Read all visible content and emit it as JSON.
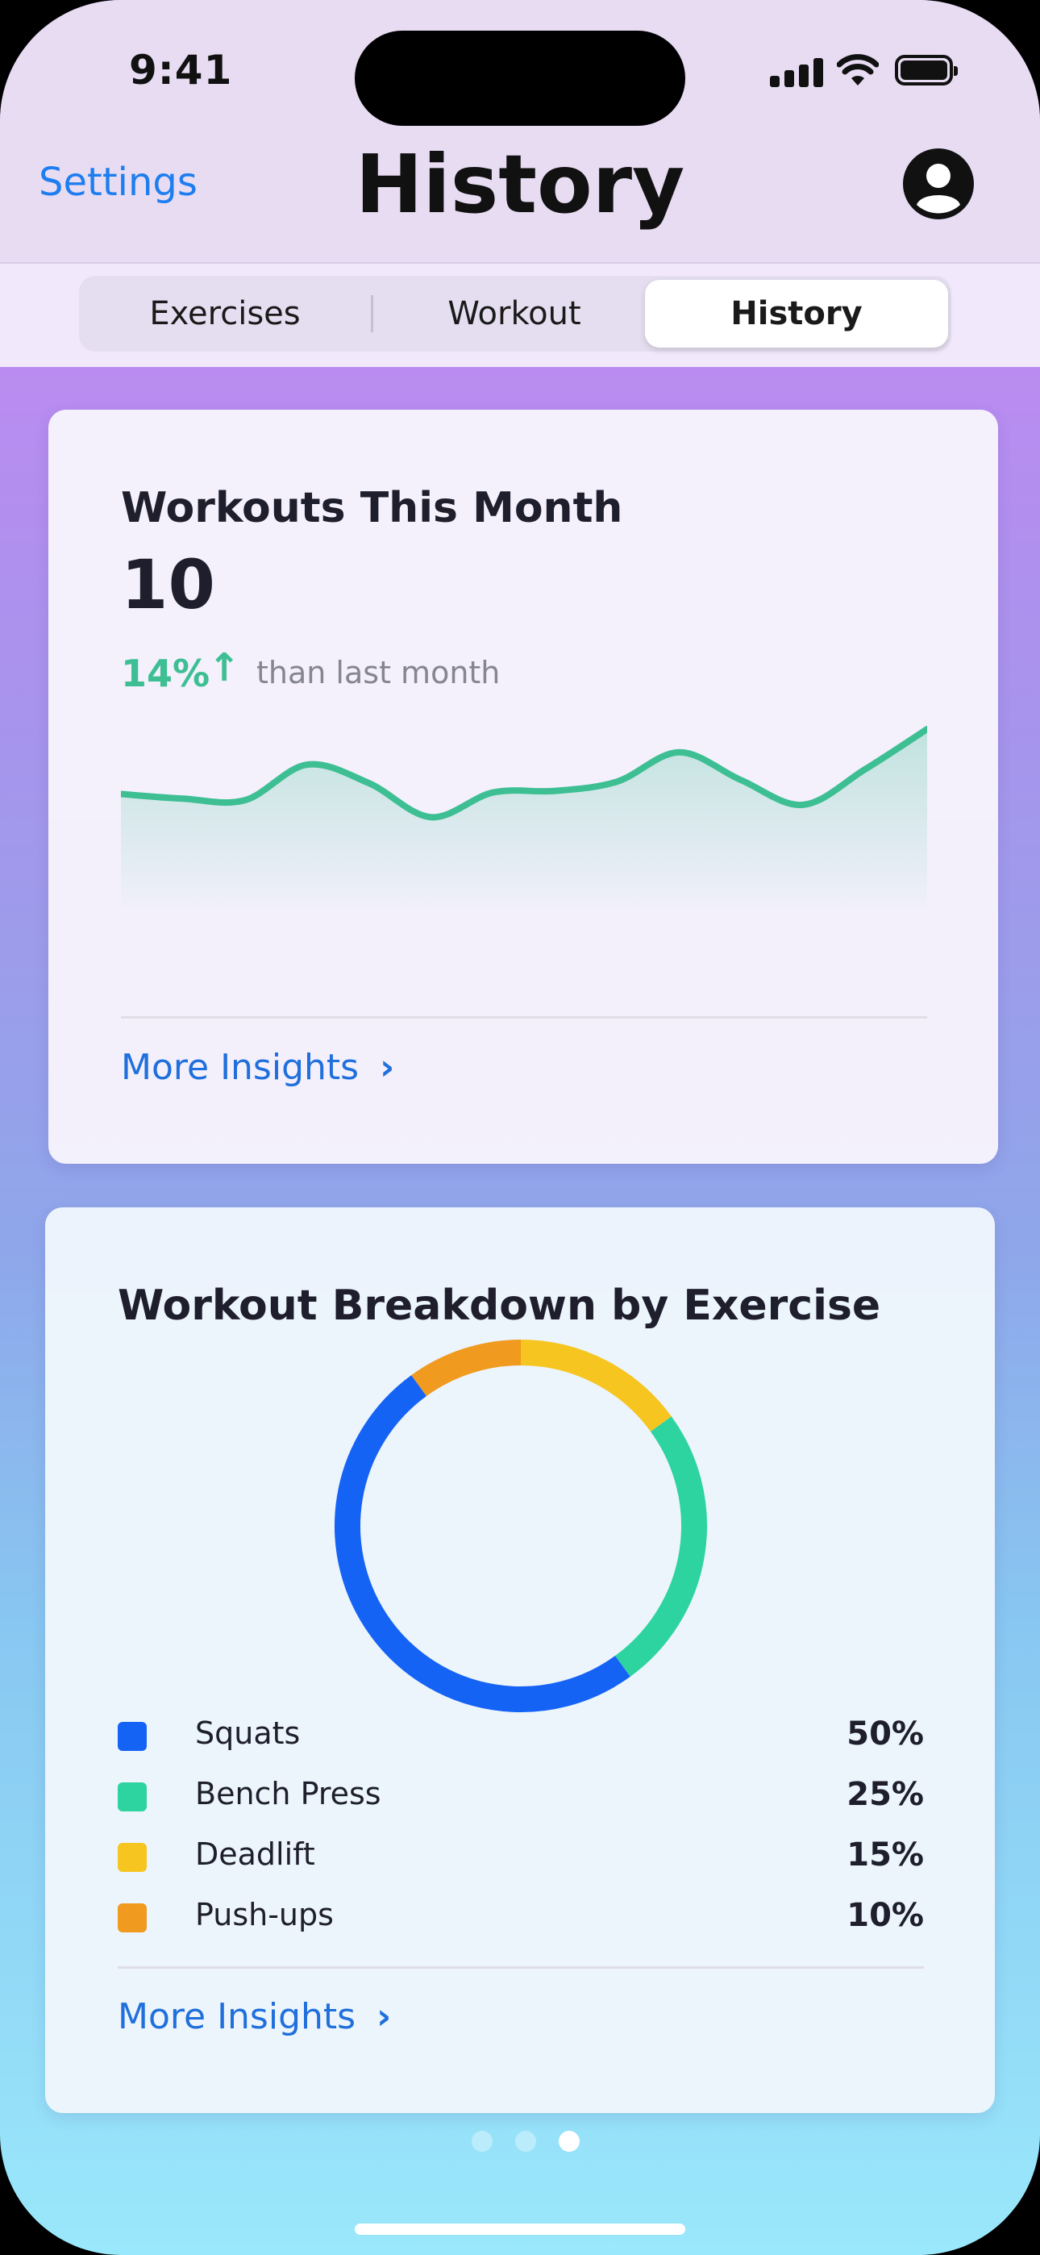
{
  "status_bar": {
    "time": "9:41"
  },
  "nav": {
    "back_label": "Settings",
    "title": "History"
  },
  "segmented": {
    "tabs": [
      "Exercises",
      "Workout",
      "History"
    ],
    "selected": "History"
  },
  "card_workouts": {
    "title": "Workouts This Month",
    "count": "10",
    "change_pct": "14%",
    "change_text": "than last month",
    "more_label": "More Insights"
  },
  "card_breakdown": {
    "title": "Workout Breakdown by Exercise",
    "more_label": "More Insights",
    "legend": [
      {
        "name": "Squats",
        "value": "50%"
      },
      {
        "name": "Bench Press",
        "value": "25%"
      },
      {
        "name": "Deadlift",
        "value": "15%"
      },
      {
        "name": "Push-ups",
        "value": "10%"
      }
    ]
  },
  "page_indicator": {
    "count": 3,
    "active": 3
  },
  "colors": {
    "accent": "#1e7ef0",
    "positive": "#3dbf93",
    "squats": "#1563f4",
    "bench_press": "#2dd49f",
    "deadlift": "#f6c520",
    "push_ups": "#f09a1f"
  },
  "chart_data": [
    {
      "type": "line",
      "x": [
        1,
        2,
        3,
        4,
        5,
        6,
        7,
        8,
        9,
        10,
        11,
        12,
        13,
        14
      ],
      "series": [
        {
          "values": [
            5.4,
            5.1,
            5.0,
            7.3,
            6.1,
            3.9,
            5.5,
            5.6,
            6.2,
            8.1,
            6.3,
            4.7,
            7.0,
            9.6
          ]
        }
      ],
      "ylim": [
        0,
        12
      ],
      "grid": false
    },
    {
      "type": "pie",
      "categories": [
        "Squats",
        "Bench Press",
        "Deadlift",
        "Push-ups"
      ],
      "values": [
        50,
        25,
        15,
        10
      ],
      "donut": true
    }
  ]
}
